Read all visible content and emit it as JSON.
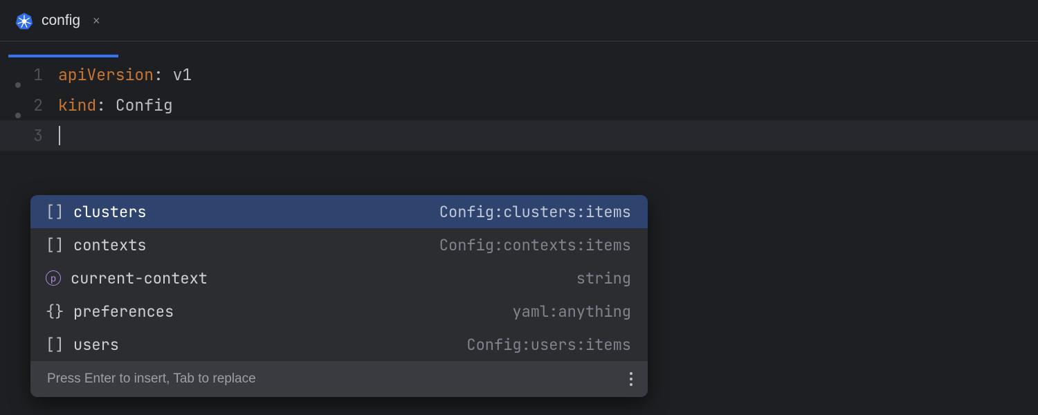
{
  "tab": {
    "title": "config"
  },
  "code": {
    "lines": [
      {
        "num": "1",
        "key": "apiVersion",
        "value": "v1"
      },
      {
        "num": "2",
        "key": "kind",
        "value": "Config"
      },
      {
        "num": "3"
      }
    ]
  },
  "popup": {
    "hint": "Press Enter to insert, Tab to replace",
    "items": [
      {
        "icon": "[]",
        "icon_kind": "brackets",
        "label": "clusters",
        "type": "Config:clusters:items",
        "selected": true
      },
      {
        "icon": "[]",
        "icon_kind": "brackets",
        "label": "contexts",
        "type": "Config:contexts:items"
      },
      {
        "icon": "p",
        "icon_kind": "p-circle",
        "label": "current-context",
        "type": "string"
      },
      {
        "icon": "{}",
        "icon_kind": "braces",
        "label": "preferences",
        "type": "yaml:anything"
      },
      {
        "icon": "[]",
        "icon_kind": "brackets",
        "label": "users",
        "type": "Config:users:items"
      }
    ]
  }
}
